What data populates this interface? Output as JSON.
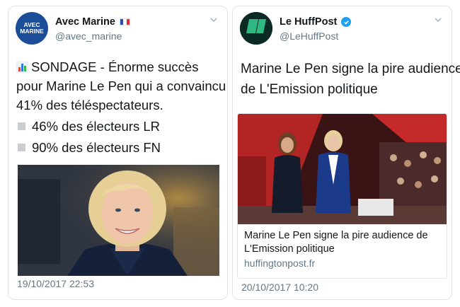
{
  "left_tweet": {
    "author_name": "Avec Marine",
    "author_flag": "French flag",
    "author_handle": "@avec_marine",
    "avatar_text": [
      "AVEC",
      "MARINE"
    ],
    "text_lines": [
      "SONDAGE - Énorme succès",
      "pour Marine Le Pen qui a convaincu",
      "41% des téléspectateurs."
    ],
    "bullets": [
      "46% des électeurs LR",
      "90% des électeurs FN"
    ],
    "timestamp": "19/10/2017 22:53",
    "icons": {
      "chart": "bar-chart-icon",
      "bullet": "white-square-icon",
      "menu": "chevron-down-icon"
    }
  },
  "right_tweet": {
    "author_name": "Le HuffPost",
    "author_handle": "@LeHuffPost",
    "avatar_text": "LE HUFFPOST",
    "verified": true,
    "text_lines": [
      "Marine Le Pen signe la pire audience",
      "de L'Emission politique"
    ],
    "card": {
      "title_lines": [
        "Marine Le Pen signe la pire audience de",
        "L'Emission politique"
      ],
      "domain": "huffingtonpost.fr"
    },
    "timestamp": "20/10/2017 10:20"
  },
  "colors": {
    "link_blue": "#1da1f2",
    "text": "#14171a",
    "muted": "#657786",
    "border": "#dfe3e6"
  }
}
